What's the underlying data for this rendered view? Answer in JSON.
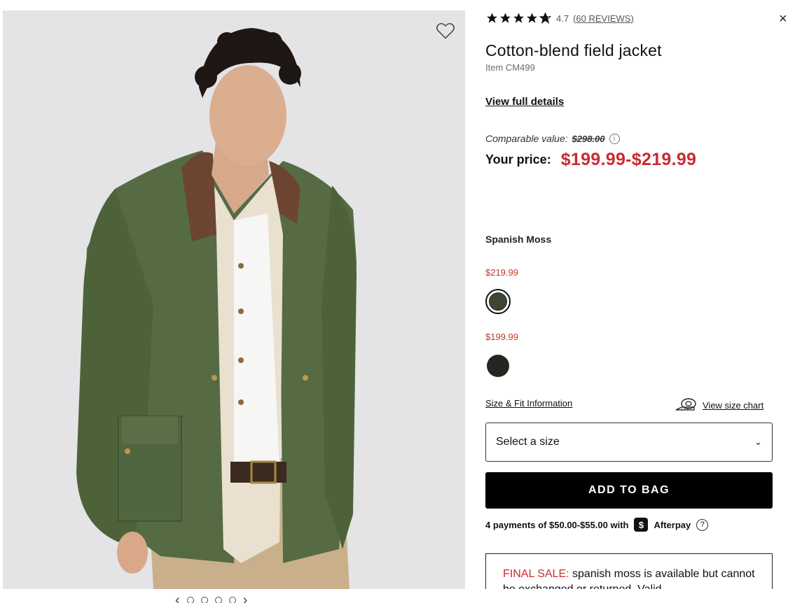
{
  "product": {
    "rating_value": "4.7",
    "reviews_text": "(60 REVIEWS)",
    "stars": 4.7,
    "title": "Cotton-blend field jacket",
    "item_code": "Item CM499",
    "view_details": "View full details"
  },
  "pricing": {
    "comparable_label": "Comparable value:",
    "comparable_price": "$298.00",
    "your_price_label": "Your price:",
    "price_range": "$199.99-$219.99"
  },
  "color": {
    "selected_name": "Spanish Moss",
    "tiers": [
      {
        "price": "$219.99",
        "swatch_color": "#3d4632",
        "selected": true
      },
      {
        "price": "$199.99",
        "swatch_color": "#24261f",
        "selected": false
      }
    ]
  },
  "size": {
    "fit_info": "Size & Fit Information",
    "size_chart": "View size chart",
    "select_placeholder": "Select a size"
  },
  "actions": {
    "add_to_bag": "ADD TO BAG"
  },
  "afterpay": {
    "text": "4 payments of $50.00-$55.00 with",
    "logo_glyph": "$",
    "brand": "Afterpay",
    "help_glyph": "?"
  },
  "final_sale": {
    "label": "FINAL SALE:",
    "text": "spanish moss is available but cannot be exchanged or returned. Valid"
  },
  "icons": {
    "close": "×",
    "info": "i",
    "chevron": "⌄"
  },
  "colors": {
    "accent_red": "#c92c33",
    "button_black": "#000000"
  }
}
